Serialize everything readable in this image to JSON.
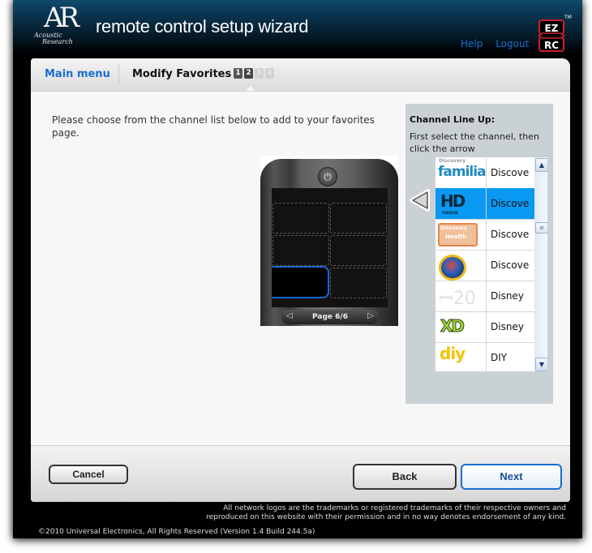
{
  "header": {
    "logo_monogram": "AR",
    "logo_brand_line1": "Acoustic",
    "logo_brand_line2": "Research",
    "app_title": "remote control setup wizard",
    "links": {
      "help": "Help",
      "logout": "Logout"
    },
    "ezrc_logo": {
      "top": "EZ",
      "bottom": "RC",
      "tm": "TM",
      "accent_color": "#d0202a"
    }
  },
  "tabs": {
    "main_menu": "Main menu",
    "current": "Modify Favorites",
    "steps": [
      {
        "label": "1",
        "state": "done"
      },
      {
        "label": "2",
        "state": "current"
      },
      {
        "label": "3",
        "state": "todo"
      },
      {
        "label": "4",
        "state": "todo"
      }
    ]
  },
  "instructions": "Please choose from the channel list below to add to your favorites page.",
  "remote": {
    "power_icon": "power-icon",
    "page_label": "Page 6/6",
    "prev_icon": "◁",
    "next_icon": "▷",
    "slots_total": 6,
    "active_slot": 5
  },
  "lineup": {
    "title": "Channel Line Up:",
    "hint": "First select the channel, then click the arrow",
    "add_arrow_icon": "left-arrow-icon",
    "channels": [
      {
        "logo": "familia",
        "name": "Discove",
        "selected": false
      },
      {
        "logo": "HD",
        "name": "Discove",
        "selected": true
      },
      {
        "logo": "Discovery Health",
        "name": "Discove",
        "selected": false
      },
      {
        "logo": "Discovery Kids",
        "name": "Discove",
        "selected": false
      },
      {
        "logo": "Disney",
        "name": "Disney",
        "selected": false
      },
      {
        "logo": "XD",
        "name": "Disney",
        "selected": false
      },
      {
        "logo": "diy",
        "name": "DIY",
        "selected": false
      }
    ],
    "selected_color": "#0a99f2"
  },
  "buttons": {
    "cancel": "Cancel",
    "back": "Back",
    "next": "Next"
  },
  "footer": {
    "legal_line1": "All network logos are the trademarks or registered trademarks of their respective owners and",
    "legal_line2": "reproduced on this website with their permission and in no way denotes endorsement of any kind.",
    "copyright": "©2010 Universal Electronics, All Rights Reserved (Version 1.4 Build 244.5a)"
  }
}
